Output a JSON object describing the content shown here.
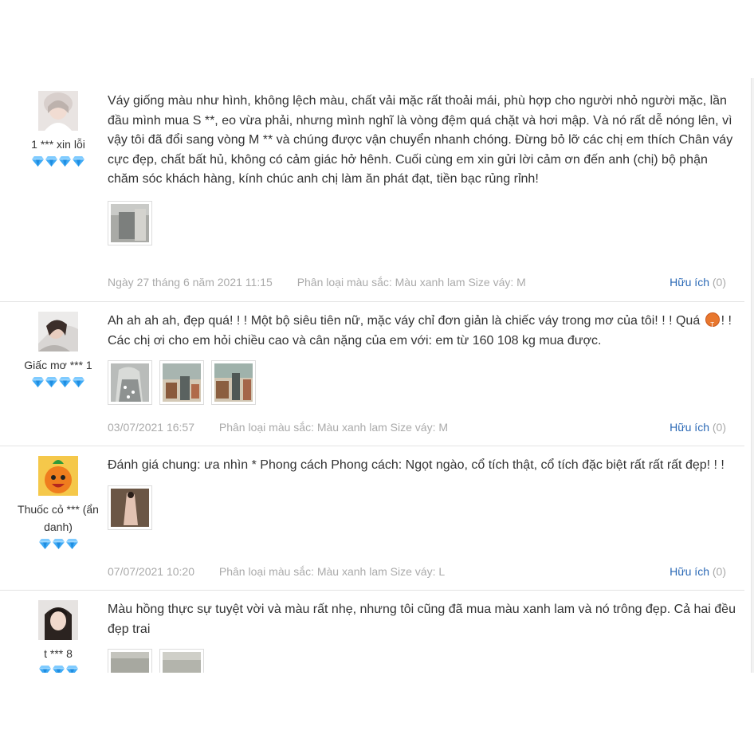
{
  "reviews": [
    {
      "user": "1 *** xin lỗi",
      "gems": 4,
      "text": "Váy giống màu như hình, không lệch màu, chất vải mặc rất thoải mái, phù hợp cho người nhỏ người mặc, lần đầu mình mua S **, eo vừa phải, nhưng mình nghĩ là vòng đệm quá chặt và hơi mập. Và nó rất dễ nóng lên, vì vậy tôi đã đổi sang vòng M ** và chúng được vận chuyển nhanh chóng. Đừng bỏ lỡ các chị em thích Chân váy cực đẹp, chất bất hủ, không có cảm giác hở hênh. Cuối cùng em xin gửi lời cảm ơn đến anh (chị) bộ phận chăm sóc khách hàng, kính chúc anh chị làm ăn phát đạt, tiền bạc rủng rỉnh!",
      "date": "Ngày 27 tháng 6 năm 2021 11:15",
      "classification": "Phân loại màu sắc: Màu xanh lam Size váy: M",
      "useful_label": "Hữu ích",
      "useful_count": "(0)"
    },
    {
      "user": "Giấc mơ *** 1",
      "gems": 4,
      "text_a": "Ah ah ah ah, đẹp quá! ! ! Một bộ siêu tiên nữ, mặc váy chỉ đơn giản là chiếc váy trong mơ của tôi! ! ! Quá ",
      "emoji": "T",
      "text_b": "! ! Các chị ơi cho em hỏi chiều cao và cân nặng của em với: em từ 160 108 kg mua được.",
      "date": "03/07/2021 16:57",
      "classification": "Phân loại màu sắc: Màu xanh lam Size váy: M",
      "useful_label": "Hữu ích",
      "useful_count": "(0)"
    },
    {
      "user": "Thuốc cỏ *** (ẩn danh)",
      "gems": 3,
      "text": "Đánh giá chung: ưa nhìn * Phong cách Phong cách: Ngọt ngào, cổ tích thật, cổ tích đặc biệt rất rất rất đẹp! ! !",
      "date": "07/07/2021 10:20",
      "classification": "Phân loại màu sắc: Màu xanh lam Size váy: L",
      "useful_label": "Hữu ích",
      "useful_count": "(0)"
    },
    {
      "user": "t *** 8",
      "gems": 3,
      "text": "Màu hồng thực sự tuyệt vời và màu rất nhẹ, nhưng tôi cũng đã mua màu xanh lam và nó trông đẹp. Cả hai đều đẹp trai"
    }
  ],
  "colors": {
    "text": "#333333",
    "muted": "#aaaaaa",
    "link": "#2a68b5",
    "gem": "#3da9f5",
    "divider": "#e3e3e3"
  },
  "icons": [
    "diamond-icon",
    "emoji-icon"
  ]
}
